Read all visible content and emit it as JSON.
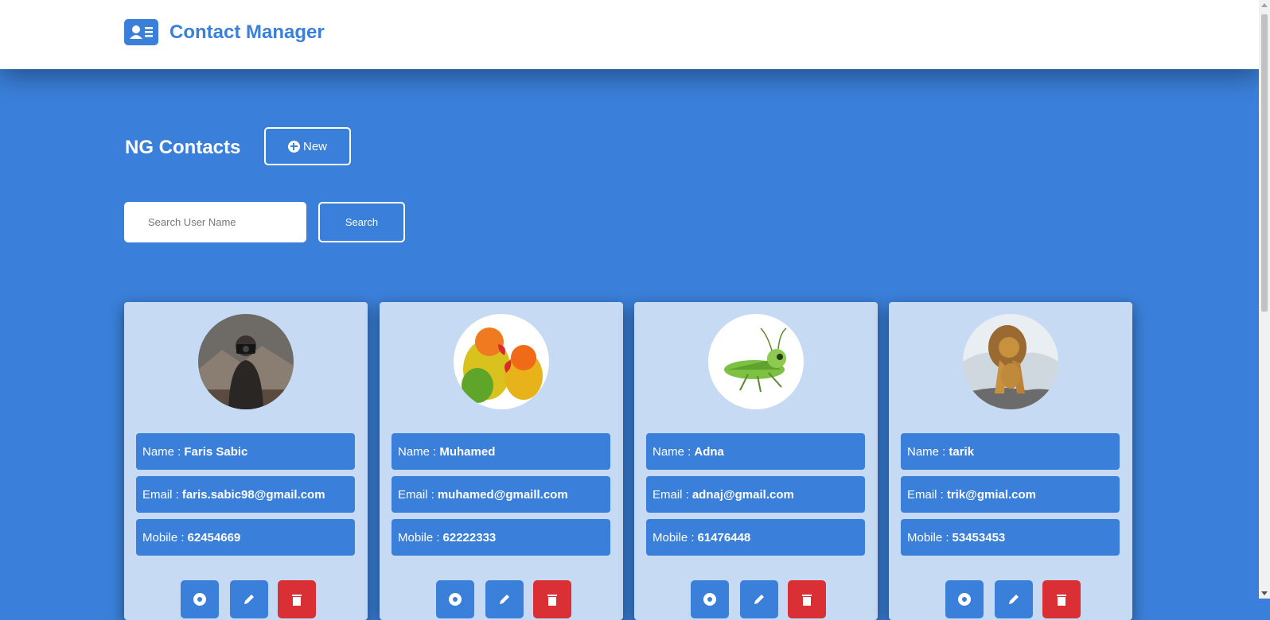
{
  "brand": {
    "title": "Contact Manager"
  },
  "page": {
    "title": "NG Contacts",
    "new_label": "New"
  },
  "search": {
    "placeholder": "Search User Name",
    "button_label": "Search"
  },
  "labels": {
    "name": "Name :",
    "email": "Email :",
    "mobile": "Mobile :"
  },
  "contacts": [
    {
      "name": "Faris Sabic",
      "email": "faris.sabic98@gmail.com",
      "mobile": "62454669",
      "avatar": "photographer-photo"
    },
    {
      "name": "Muhamed",
      "email": "muhamed@gmaill.com",
      "mobile": "62222333",
      "avatar": "parrots-photo"
    },
    {
      "name": "Adna",
      "email": "adnaj@gmail.com",
      "mobile": "61476448",
      "avatar": "grasshopper-illustration"
    },
    {
      "name": "tarik",
      "email": "trik@gmial.com",
      "mobile": "53453453",
      "avatar": "lion-photo"
    }
  ],
  "colors": {
    "primary": "#3a7fd9",
    "card": "#c6daf4",
    "danger": "#d92f35"
  }
}
